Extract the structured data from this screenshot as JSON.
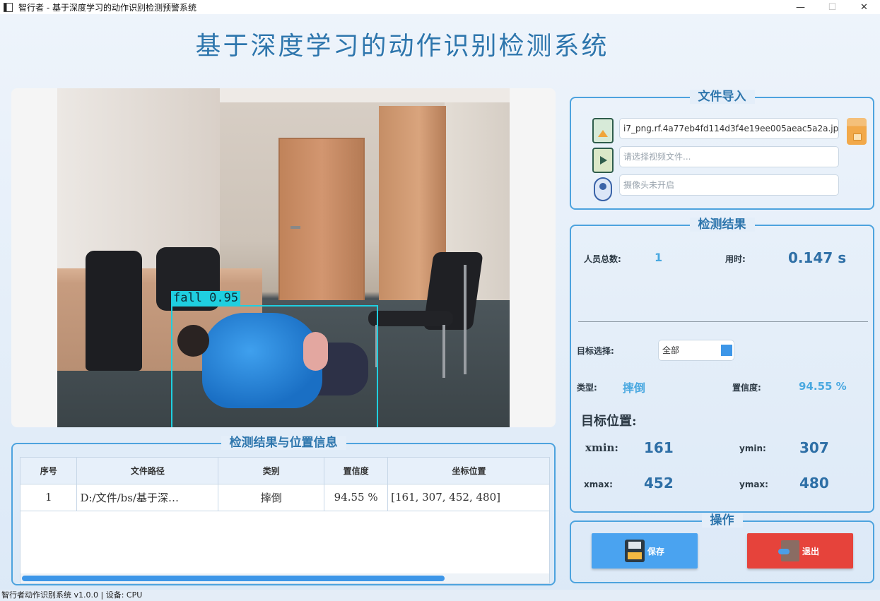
{
  "window": {
    "title": "智行者 - 基于深度学习的动作识别检测预警系统",
    "minimize": "—",
    "maximize": "☐",
    "close": "✕"
  },
  "header": {
    "title": "基于深度学习的动作识别检测系统"
  },
  "detection_overlay": {
    "label": "fall 0.95",
    "color": "#1fcfe0"
  },
  "table_panel": {
    "title": "检测结果与位置信息",
    "columns": [
      "序号",
      "文件路径",
      "类别",
      "置信度",
      "坐标位置"
    ],
    "rows": [
      [
        "1",
        "D:/文件/bs/基于深…",
        "摔倒",
        "94.55 %",
        "[161, 307, 452, 480]"
      ]
    ]
  },
  "import_panel": {
    "title": "文件导入",
    "image_path": "i7_png.rf.4a77eb4fd114d3f4e19ee005aeac5a2a.jpg",
    "video_placeholder": "请选择视频文件...",
    "camera_placeholder": "摄像头未开启"
  },
  "result_panel": {
    "title": "检测结果",
    "total_label": "人员总数:",
    "total_value": "1",
    "time_label": "用时:",
    "time_value": "0.147 s",
    "target_label": "目标选择:",
    "target_value": "全部",
    "type_label": "类型:",
    "type_value": "摔倒",
    "conf_label": "置信度:",
    "conf_value": "94.55 %",
    "position_title": "目标位置:",
    "xmin_label": "xmin:",
    "xmin_value": "161",
    "ymin_label": "ymin:",
    "ymin_value": "307",
    "xmax_label": "xmax:",
    "xmax_value": "452",
    "ymax_label": "ymax:",
    "ymax_value": "480"
  },
  "ops_panel": {
    "title": "操作",
    "save_label": "保存",
    "exit_label": "退出"
  },
  "status": {
    "text": "智行者动作识别系统 v1.0.0 | 设备: CPU"
  },
  "colors": {
    "accent": "#2e76ad",
    "save": "#4aa3f0",
    "exit": "#e6433b",
    "value": "#49a8e0"
  }
}
